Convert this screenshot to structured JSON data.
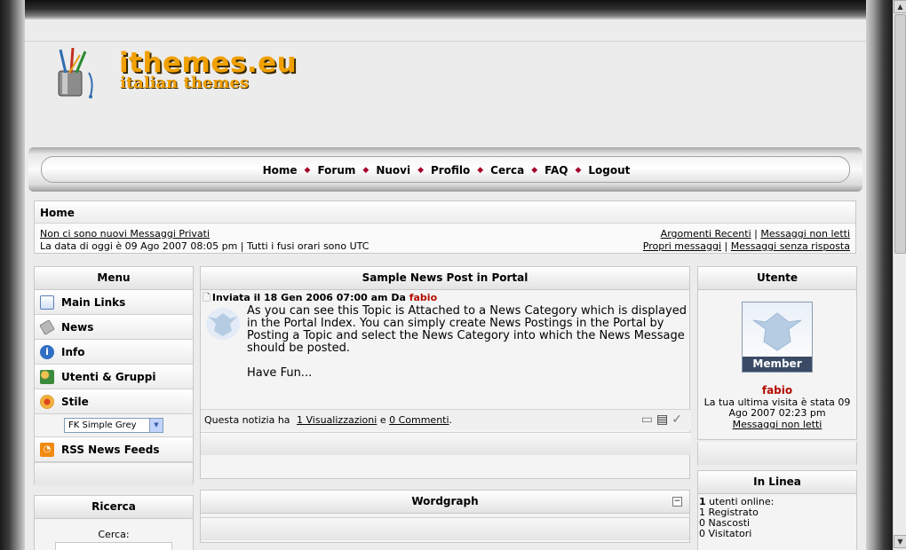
{
  "logo": {
    "title": "ithemes.eu",
    "subtitle": "italian themes"
  },
  "nav": [
    "Home",
    "Forum",
    "Nuovi",
    "Profilo",
    "Cerca",
    "FAQ",
    "Logout"
  ],
  "info": {
    "title": "Home",
    "private_messages": "Non ci sono nuovi Messaggi Privati",
    "date_line": "La data di oggi è 09 Ago 2007 08:05 pm | Tutti i fusi orari sono UTC",
    "link_recent": "Argomenti Recenti",
    "link_unread": "Messaggi non letti",
    "link_own": "Propri messaggi",
    "link_unanswered": "Messaggi senza risposta"
  },
  "menu": {
    "title": "Menu",
    "items": [
      "Main Links",
      "News",
      "Info",
      "Utenti & Gruppi",
      "Stile"
    ],
    "style_select": "FK Simple Grey",
    "rss": "RSS News Feeds"
  },
  "search": {
    "title": "Ricerca",
    "label": "Cerca:"
  },
  "post": {
    "title": "Sample News Post in Portal",
    "meta_prefix": "Inviata il  18 Gen 2006 07:00 am Da",
    "author": "fabio",
    "body_p1": "As you can see this Topic is Attached to a News Category which is displayed in the Portal Index. You can simply create News Postings in the Portal by Posting a Topic and select the News Category into which the News Message should be posted.",
    "body_p2": "Have Fun...",
    "foot_prefix": "Questa notizia ha",
    "views": "1 Visualizzazioni",
    "foot_and": "e",
    "comments": "0 Commenti",
    "foot_suffix": "."
  },
  "wordgraph": {
    "title": "Wordgraph"
  },
  "user": {
    "title": "Utente",
    "avatar_label": "Member",
    "name": "fabio",
    "last_visit": "La tua ultima visita è stata 09 Ago 2007 02:23 pm",
    "unread_link": "Messaggi non letti"
  },
  "online": {
    "title": "In Linea",
    "users_count": "1",
    "users_text": "utenti online:",
    "registered": "1 Registrato",
    "hidden": "0 Nascosti",
    "guests": "0 Visitatori"
  },
  "colors": {
    "accent": "#a5002a",
    "author": "#b30c00",
    "logo": "#f0a000"
  }
}
